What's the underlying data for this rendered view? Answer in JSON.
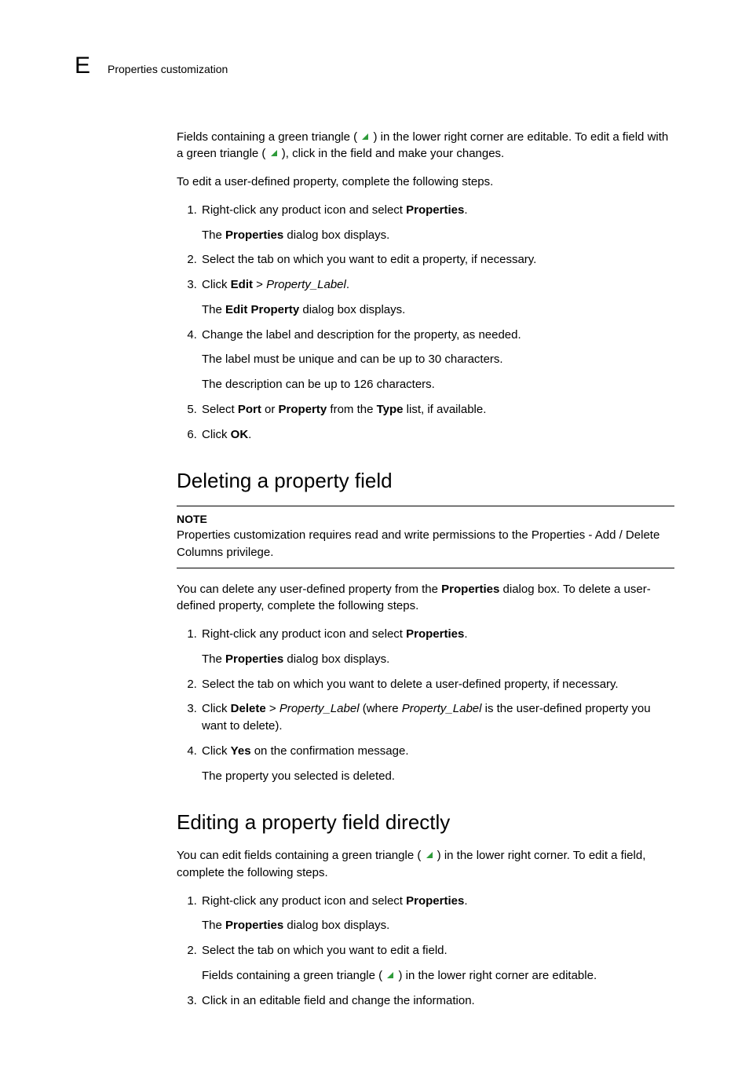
{
  "header": {
    "letter": "E",
    "title": "Properties customization"
  },
  "section1": {
    "intro1a": "Fields containing a green triangle (",
    "intro1b": ") in the lower right corner are editable. To edit a field with a green triangle (",
    "intro1c": "), click in the field and make your changes.",
    "intro2": "To edit a user-defined property, complete the following steps.",
    "steps": [
      {
        "text_before": "Right-click any product icon and select ",
        "bold": "Properties",
        "text_after": ".",
        "sub": [
          {
            "before": "The ",
            "bold": "Properties",
            "after": " dialog box displays."
          }
        ]
      },
      {
        "plain": "Select the tab on which you want to edit a property, if necessary."
      },
      {
        "text_before": "Click ",
        "bold": "Edit",
        "text_mid": " > ",
        "italic": "Property_Label",
        "text_after": ".",
        "sub": [
          {
            "before": "The ",
            "bold": "Edit Property",
            "after": " dialog box displays."
          }
        ]
      },
      {
        "plain": "Change the label and description for the property, as needed.",
        "sub": [
          {
            "plain": "The label must be unique and can be up to 30 characters."
          },
          {
            "plain": "The description can be up to 126 characters."
          }
        ]
      },
      {
        "t0": "Select ",
        "b0": "Port",
        "t1": " or ",
        "b1": "Property",
        "t2": " from the ",
        "b2": "Type",
        "t3": " list, if available."
      },
      {
        "text_before": "Click ",
        "bold": "OK",
        "text_after": "."
      }
    ]
  },
  "section2": {
    "heading": "Deleting a property field",
    "note_label": "NOTE",
    "note_text": "Properties customization requires read and write permissions to the Properties - Add / Delete Columns privilege.",
    "intro_a": "You can delete any user-defined property from the ",
    "intro_bold": "Properties",
    "intro_b": " dialog box. To delete a user-defined property, complete the following steps.",
    "steps": [
      {
        "text_before": "Right-click any product icon and select ",
        "bold": "Properties",
        "text_after": ".",
        "sub": [
          {
            "before": "The ",
            "bold": "Properties",
            "after": " dialog box displays."
          }
        ]
      },
      {
        "plain": "Select the tab on which you want to delete a user-defined property, if necessary."
      },
      {
        "t0": "Click ",
        "b0": "Delete",
        "t1": " > ",
        "i0": "Property_Label",
        "t2": " (where ",
        "i1": "Property_Label",
        "t3": " is the user-defined property you want to delete)."
      },
      {
        "text_before": "Click ",
        "bold": "Yes",
        "text_after": " on the confirmation message.",
        "sub": [
          {
            "plain": "The property you selected is deleted."
          }
        ]
      }
    ]
  },
  "section3": {
    "heading": "Editing a property field directly",
    "intro_a": "You can edit fields containing a green triangle (",
    "intro_b": ") in the lower right corner. To edit a field, complete the following steps.",
    "steps": [
      {
        "text_before": "Right-click any product icon and select ",
        "bold": "Properties",
        "text_after": ".",
        "sub": [
          {
            "before": "The ",
            "bold": "Properties",
            "after": " dialog box displays."
          }
        ]
      },
      {
        "plain": "Select the tab on which you want to edit a field.",
        "sub": [
          {
            "before_tri": "Fields containing a green triangle (",
            "after_tri": ") in the lower right corner are editable."
          }
        ]
      },
      {
        "plain": "Click in an editable field and change the information."
      }
    ]
  }
}
